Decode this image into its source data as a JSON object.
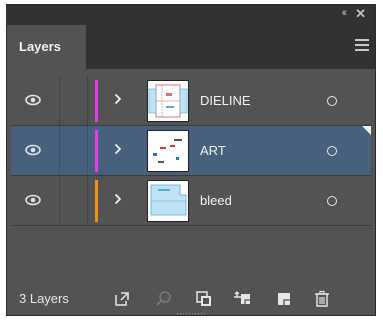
{
  "panel": {
    "tab_label": "Layers",
    "collapse_glyph": "‹‹",
    "close_glyph": "✕"
  },
  "layers": [
    {
      "name": "DIELINE",
      "color": "#e040e8",
      "visible": true,
      "selected": false,
      "thumbnail": "dieline-artwork"
    },
    {
      "name": "ART",
      "color": "#e040e8",
      "visible": true,
      "selected": true,
      "thumbnail": "art-artwork"
    },
    {
      "name": "bleed",
      "color": "#f0901c",
      "visible": true,
      "selected": false,
      "thumbnail": "bleed-artwork"
    }
  ],
  "footer": {
    "layer_count": "3 Layers",
    "icons": [
      "export-icon",
      "locate-object-icon",
      "clipping-mask-icon",
      "new-sublayer-icon",
      "new-layer-icon",
      "delete-icon"
    ]
  },
  "colors": {
    "panel_bg": "#535353",
    "titlebar_bg": "#323232",
    "selected_row": "#46607d"
  }
}
